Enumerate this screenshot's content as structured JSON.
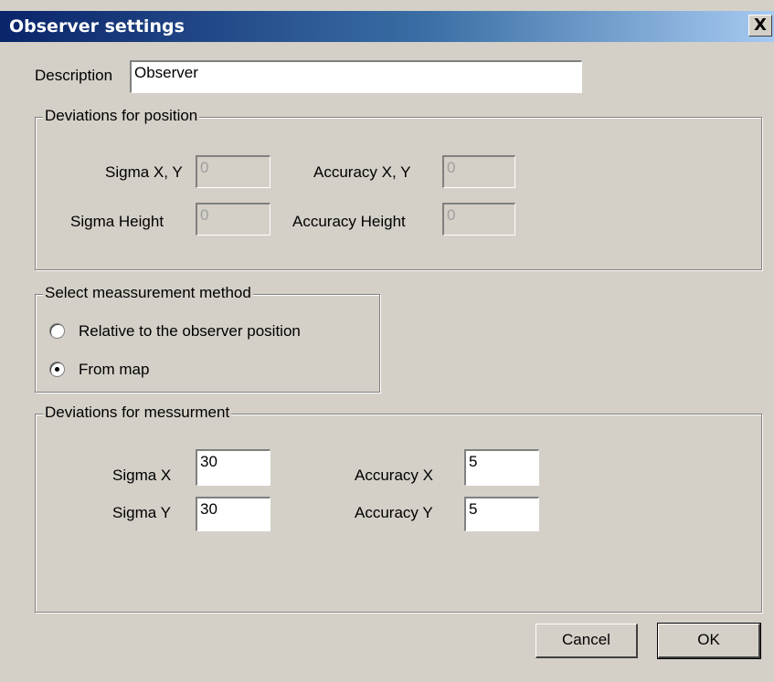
{
  "dialog": {
    "title": "Observer settings",
    "close_glyph": "X"
  },
  "description": {
    "label": "Description",
    "value": "Observer"
  },
  "position_group": {
    "title": "Deviations for position",
    "sigma_xy_label": "Sigma X, Y",
    "sigma_xy_value": "0",
    "accuracy_xy_label": "Accuracy X, Y",
    "accuracy_xy_value": "0",
    "sigma_height_label": "Sigma Height",
    "sigma_height_value": "0",
    "accuracy_height_label": "Accuracy Height",
    "accuracy_height_value": "0"
  },
  "method_group": {
    "title": "Select meassurement method",
    "options": [
      {
        "label": "Relative to the observer position",
        "selected": false
      },
      {
        "label": "From map",
        "selected": true
      }
    ]
  },
  "measurement_group": {
    "title": "Deviations for messurment",
    "sigma_x_label": "Sigma X",
    "sigma_x_value": "30",
    "accuracy_x_label": "Accuracy X",
    "accuracy_x_value": "5",
    "sigma_y_label": "Sigma Y",
    "sigma_y_value": "30",
    "accuracy_y_label": "Accuracy Y",
    "accuracy_y_value": "5"
  },
  "buttons": {
    "cancel": "Cancel",
    "ok": "OK"
  }
}
